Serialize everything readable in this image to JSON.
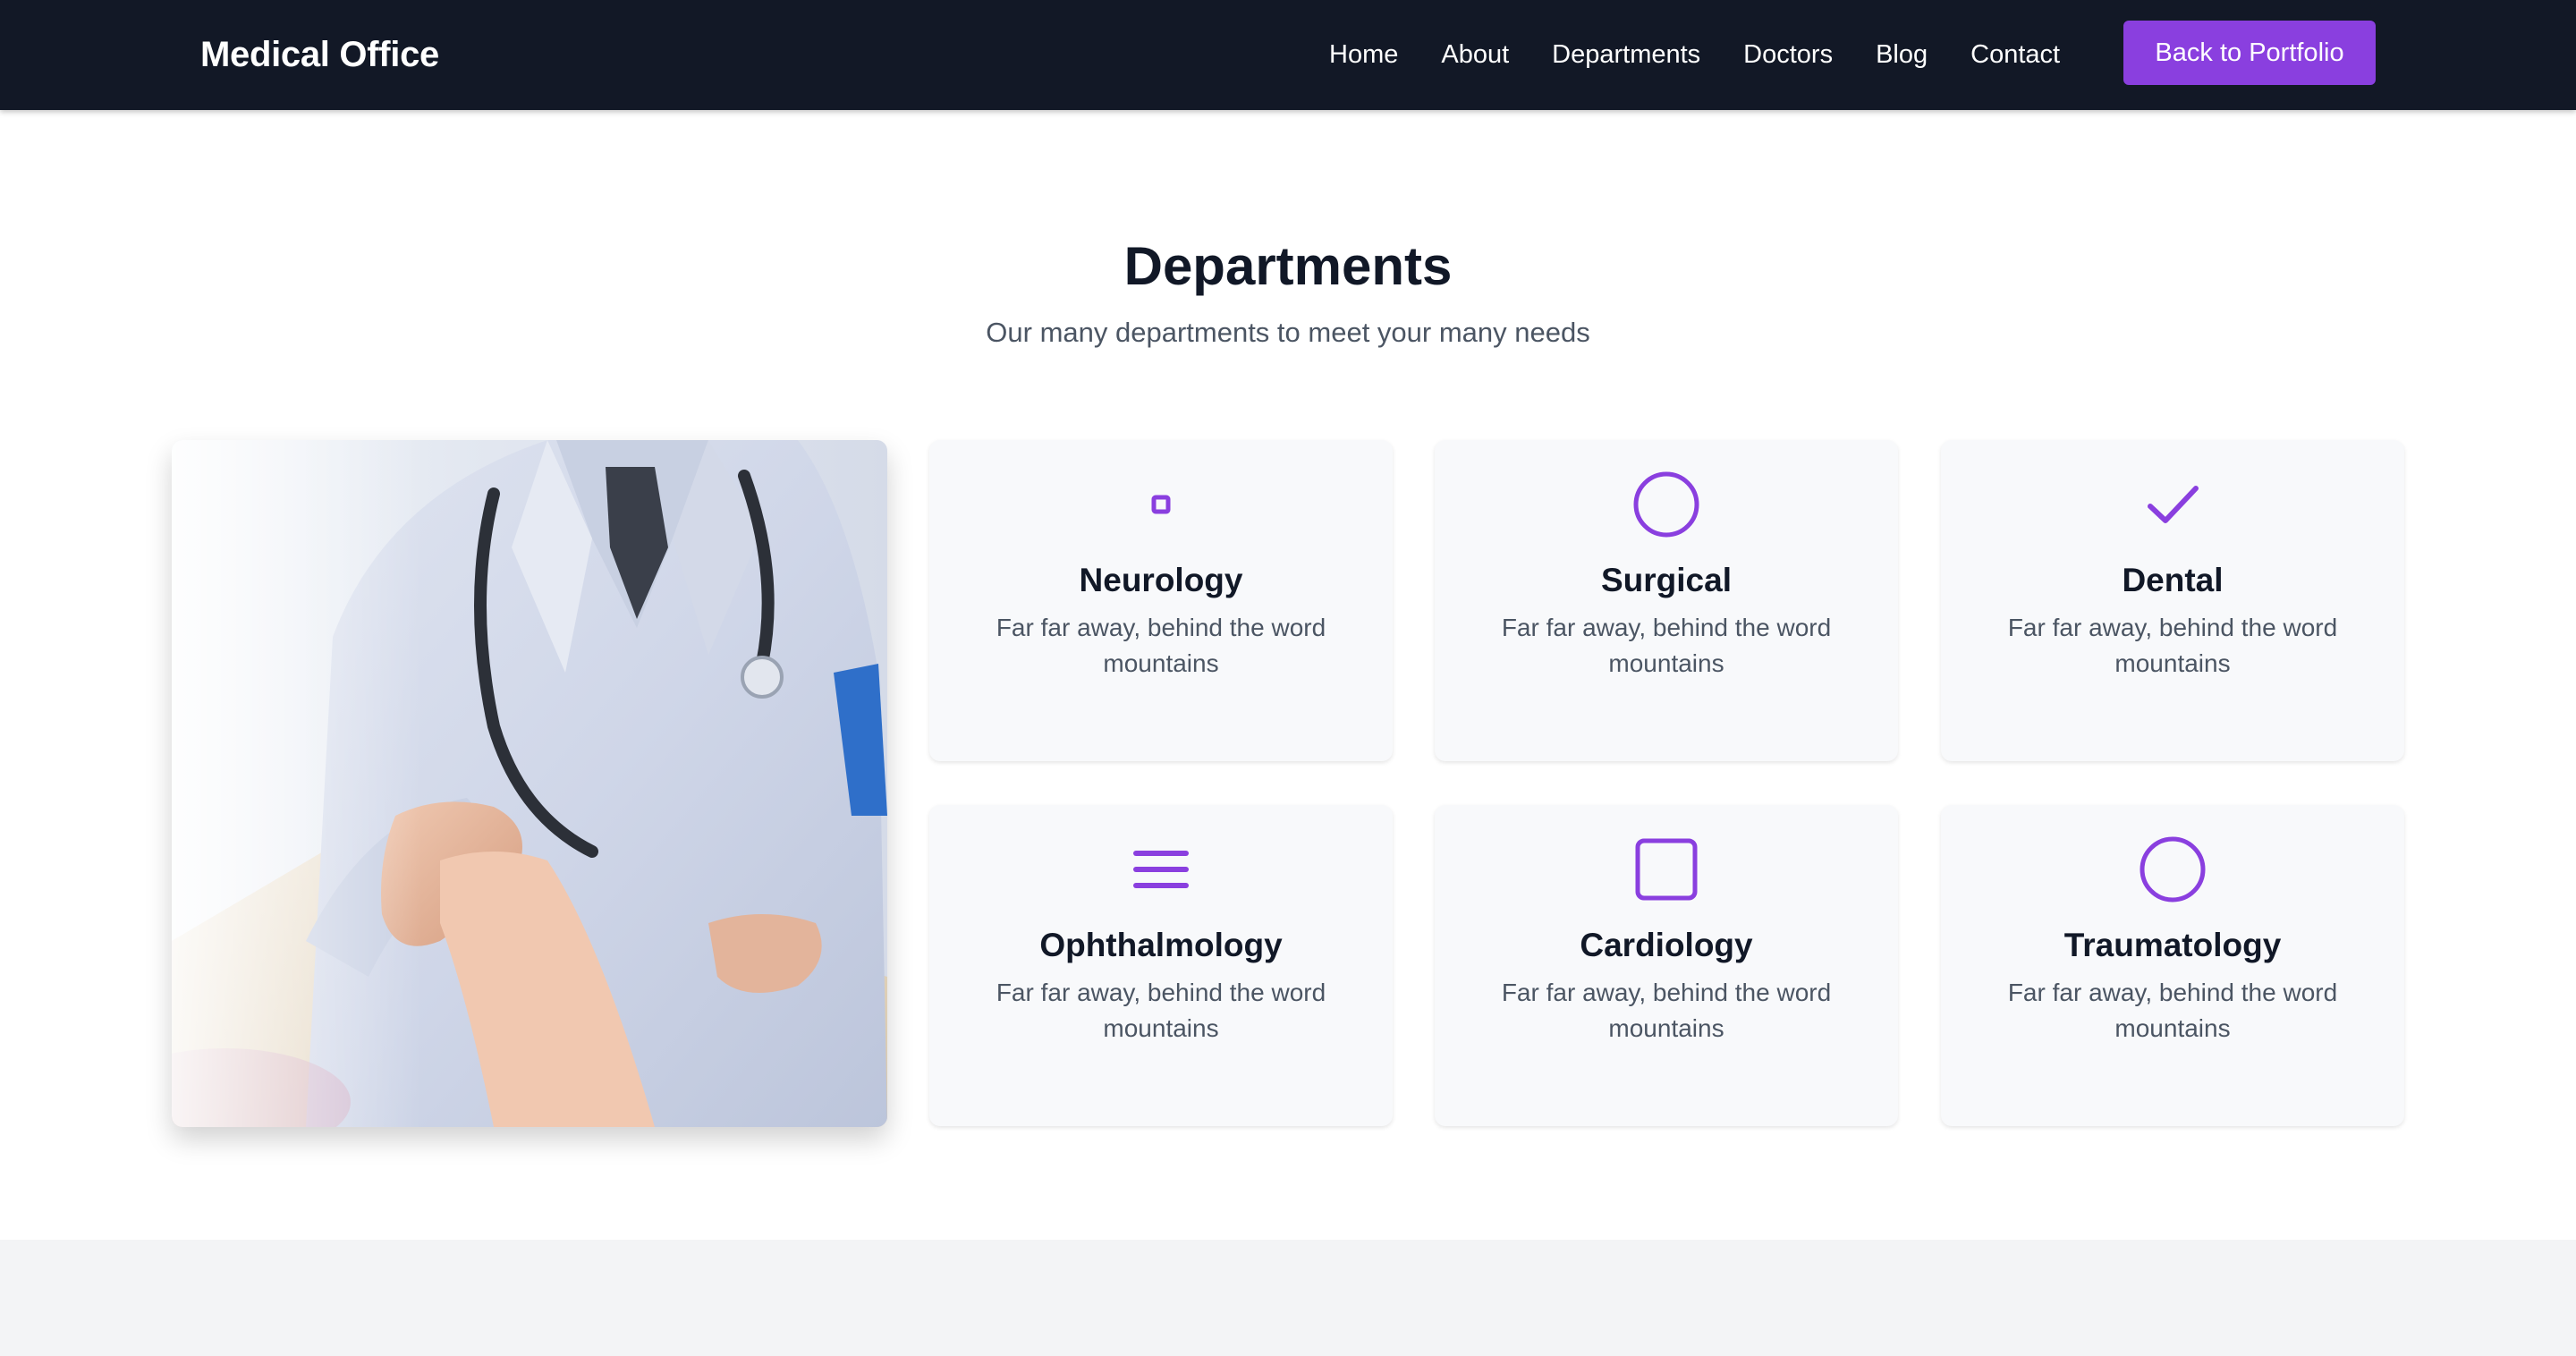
{
  "nav": {
    "brand": "Medical Office",
    "links": [
      "Home",
      "About",
      "Departments",
      "Doctors",
      "Blog",
      "Contact"
    ],
    "portfolio_button": "Back to Portfolio"
  },
  "departments": {
    "title": "Departments",
    "subtitle": "Our many departments to meet your many needs",
    "image_alt": "doctor-handshake-photo",
    "cards": [
      {
        "title": "Neurology",
        "description": "Far far away, behind the word mountains",
        "icon": "small-square-icon"
      },
      {
        "title": "Surgical",
        "description": "Far far away, behind the word mountains",
        "icon": "circle-icon"
      },
      {
        "title": "Dental",
        "description": "Far far away, behind the word mountains",
        "icon": "checkmark-icon"
      },
      {
        "title": "Ophthalmology",
        "description": "Far far away, behind the word mountains",
        "icon": "menu-icon"
      },
      {
        "title": "Cardiology",
        "description": "Far far away, behind the word mountains",
        "icon": "rounded-square-icon"
      },
      {
        "title": "Traumatology",
        "description": "Far far away, behind the word mountains",
        "icon": "circle-icon"
      }
    ]
  },
  "colors": {
    "nav_background": "#121826",
    "accent": "#8a3fdf",
    "card_background": "#f8f9fb",
    "heading_text": "#111827",
    "body_text": "#4b5563",
    "footer_background": "#f3f4f6"
  }
}
